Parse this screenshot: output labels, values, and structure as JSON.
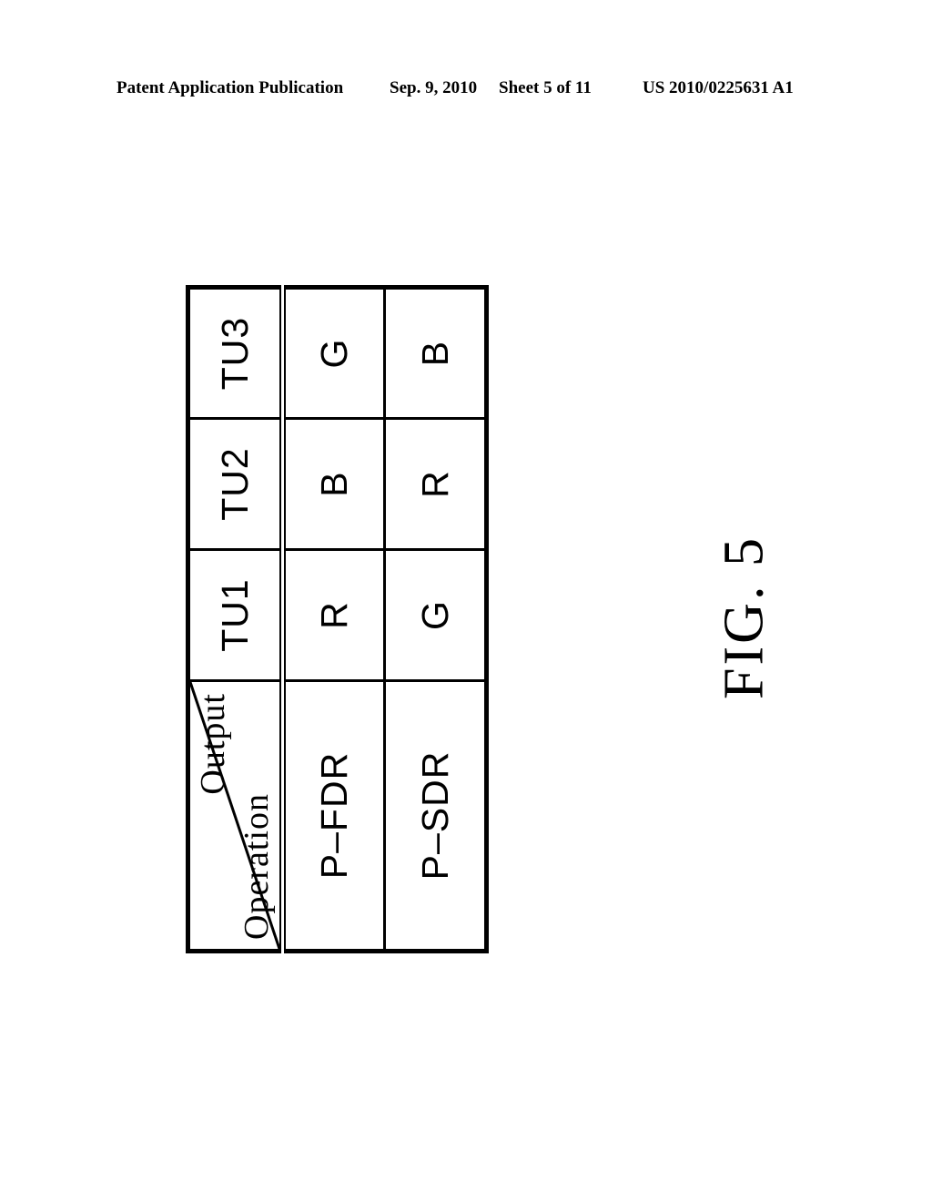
{
  "header": {
    "publication": "Patent Application Publication",
    "date": "Sep. 9, 2010",
    "sheet": "Sheet 5 of 11",
    "number": "US 2010/0225631 A1"
  },
  "figure": {
    "caption": "FIG. 5",
    "corner": {
      "upper_label": "Output",
      "lower_label": "Operation"
    },
    "column_headers": [
      "TU1",
      "TU2",
      "TU3"
    ],
    "rows": [
      {
        "label": "P–FDR",
        "values": [
          "R",
          "B",
          "G"
        ]
      },
      {
        "label": "P–SDR",
        "values": [
          "G",
          "R",
          "B"
        ]
      }
    ]
  },
  "chart_data": {
    "type": "table",
    "title": "FIG. 5",
    "corner_header_upper": "Output",
    "corner_header_lower": "Operation",
    "columns": [
      "TU1",
      "TU2",
      "TU3"
    ],
    "row_labels": [
      "P–FDR",
      "P–SDR"
    ],
    "cells": [
      [
        "R",
        "B",
        "G"
      ],
      [
        "G",
        "R",
        "B"
      ]
    ],
    "orientation": "rotated-90-ccw",
    "grid": true,
    "legend": "none"
  }
}
